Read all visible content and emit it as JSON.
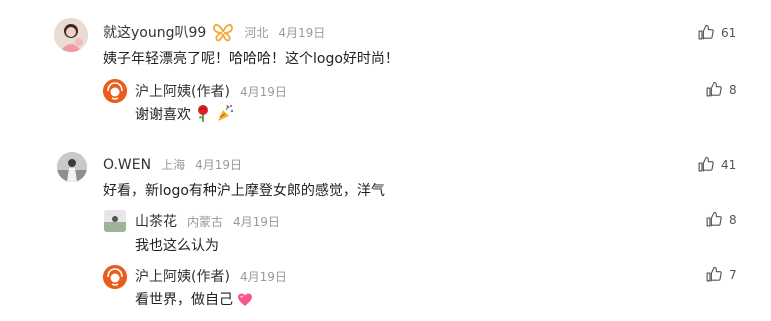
{
  "comments": [
    {
      "user": "就这young叭99",
      "location": "河北",
      "date": "4月19日",
      "text": "姨子年轻漂亮了呢！哈哈哈！这个logo好时尚！",
      "likes": "61",
      "replies": [
        {
          "user": "沪上阿姨(作者)",
          "date": "4月19日",
          "text": "谢谢喜欢",
          "likes": "8"
        }
      ]
    },
    {
      "user": "O.WEN",
      "location": "上海",
      "date": "4月19日",
      "text": "好看，新logo有种沪上摩登女郎的感觉，洋气",
      "likes": "41",
      "replies": [
        {
          "user": "山茶花",
          "location": "内蒙古",
          "date": "4月19日",
          "text": "我也这么认为",
          "likes": "8"
        },
        {
          "user": "沪上阿姨(作者)",
          "date": "4月19日",
          "text": "看世界，做自己",
          "likes": "7"
        }
      ]
    }
  ],
  "icons": {
    "like": "thumbs-up-icon",
    "badge": "butterfly-badge-icon",
    "rose": "rose-emoji",
    "party": "party-popper-emoji",
    "heart": "pink-heart-emoji"
  },
  "colors": {
    "brand_orange": "#e85d1f",
    "meta_gray": "#9a9a9a",
    "badge_orange": "#f3a93c"
  }
}
